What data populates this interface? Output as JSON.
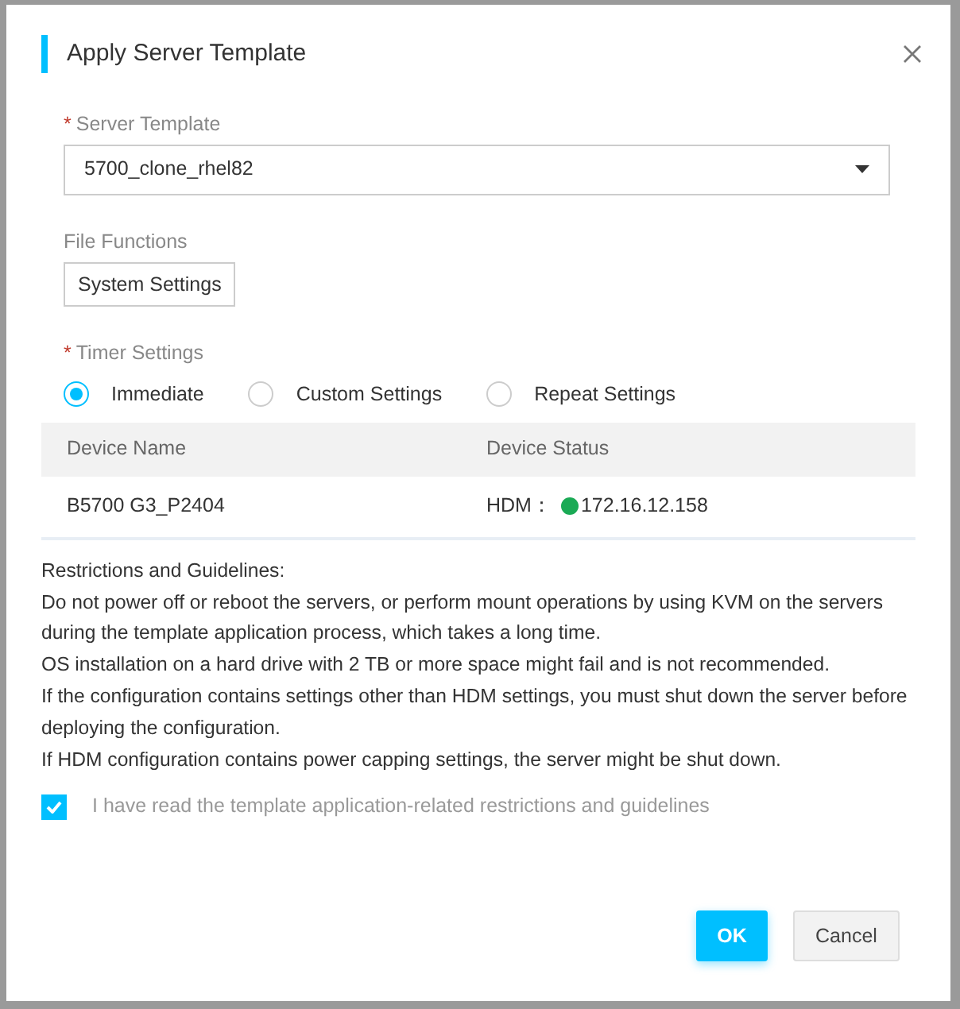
{
  "dialog": {
    "title": "Apply Server Template",
    "server_template": {
      "required_mark": "*",
      "label": "Server Template",
      "value": "5700_clone_rhel82"
    },
    "file_functions": {
      "label": "File Functions",
      "items": [
        "System Settings"
      ]
    },
    "timer_settings": {
      "required_mark": "*",
      "label": "Timer Settings",
      "options": [
        {
          "label": "Immediate",
          "selected": true
        },
        {
          "label": "Custom Settings",
          "selected": false
        },
        {
          "label": "Repeat Settings",
          "selected": false
        }
      ]
    },
    "table": {
      "columns": [
        "Device Name",
        "Device Status"
      ],
      "rows": [
        {
          "device_name": "B5700 G3_P2404",
          "status_prefix": "HDM：",
          "color": "#1aaa55",
          "address": "172.16.12.158"
        }
      ]
    },
    "guidelines": {
      "title": "Restrictions and Guidelines:",
      "items": [
        "Do not power off or reboot the servers, or perform mount operations by using KVM on the servers during the template application process, which takes a long time.",
        "OS installation on a hard drive with 2 TB or more space might fail and is not recommended.",
        "If the configuration contains settings other than HDM settings, you must shut down the server before deploying the configuration.",
        "If HDM configuration contains power capping settings, the server might be shut down."
      ]
    },
    "acknowledge": {
      "label": "I have read the template application-related restrictions and guidelines",
      "checked": true
    },
    "buttons": [
      {
        "label": "OK",
        "kind": "primary"
      },
      {
        "label": "Cancel",
        "kind": "secondary"
      }
    ]
  }
}
